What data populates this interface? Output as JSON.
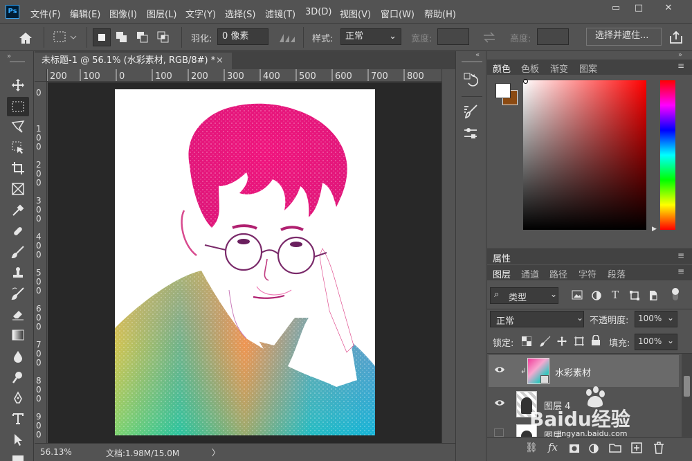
{
  "app": {
    "logo": "Ps"
  },
  "menubar": {
    "items": [
      "文件(F)",
      "编辑(E)",
      "图像(I)",
      "图层(L)",
      "文字(Y)",
      "选择(S)",
      "滤镜(T)",
      "3D(D)",
      "视图(V)",
      "窗口(W)",
      "帮助(H)"
    ],
    "window_controls": [
      "▭",
      "□",
      "✕"
    ]
  },
  "options": {
    "feather_label": "羽化:",
    "feather_value": "0 像素",
    "style_label": "样式:",
    "style_value": "正常",
    "width_label": "宽度:",
    "height_label": "高度:",
    "select_mask_button": "选择并遮住..."
  },
  "document": {
    "tab_title": "未标题-1 @ 56.1% (水彩素材, RGB/8#) *",
    "close": "×",
    "ruler_h": [
      "200",
      "100",
      "0",
      "100",
      "200",
      "300",
      "400",
      "500",
      "600",
      "700",
      "800"
    ],
    "ruler_v": [
      "0",
      "1\n0\n0",
      "2\n0\n0",
      "3\n0\n0",
      "4\n0\n0",
      "5\n0\n0",
      "6\n0\n0",
      "7\n0\n0",
      "8\n0\n0",
      "9\n0\n0"
    ]
  },
  "status": {
    "zoom": "56.13%",
    "doc_info": "文档:1.98M/15.0M",
    "arrow": "〉"
  },
  "color_panel": {
    "tabs": [
      "颜色",
      "色板",
      "渐变",
      "图案"
    ],
    "foreground": "#ffffff",
    "background": "#8b4a12"
  },
  "properties_panel": {
    "title": "属性"
  },
  "layers_panel": {
    "tabs": [
      "图层",
      "通道",
      "路径",
      "字符",
      "段落"
    ],
    "filter_label": "类型",
    "blend_mode": "正常",
    "opacity_label": "不透明度:",
    "opacity_value": "100%",
    "lock_label": "锁定:",
    "fill_label": "填充:",
    "fill_value": "100%",
    "layers": [
      {
        "name": "水彩素材",
        "clipped": true,
        "selected": true
      },
      {
        "name": "图层 4",
        "clipped": false,
        "selected": false
      },
      {
        "name": "图层",
        "clipped": false,
        "selected": false
      }
    ]
  },
  "watermark": {
    "text": "Baidu经验",
    "url": "jingyan.baidu.com"
  },
  "colors": {
    "accent": "#31a8ff",
    "panel_bg": "#535353",
    "dark_bg": "#282828"
  }
}
